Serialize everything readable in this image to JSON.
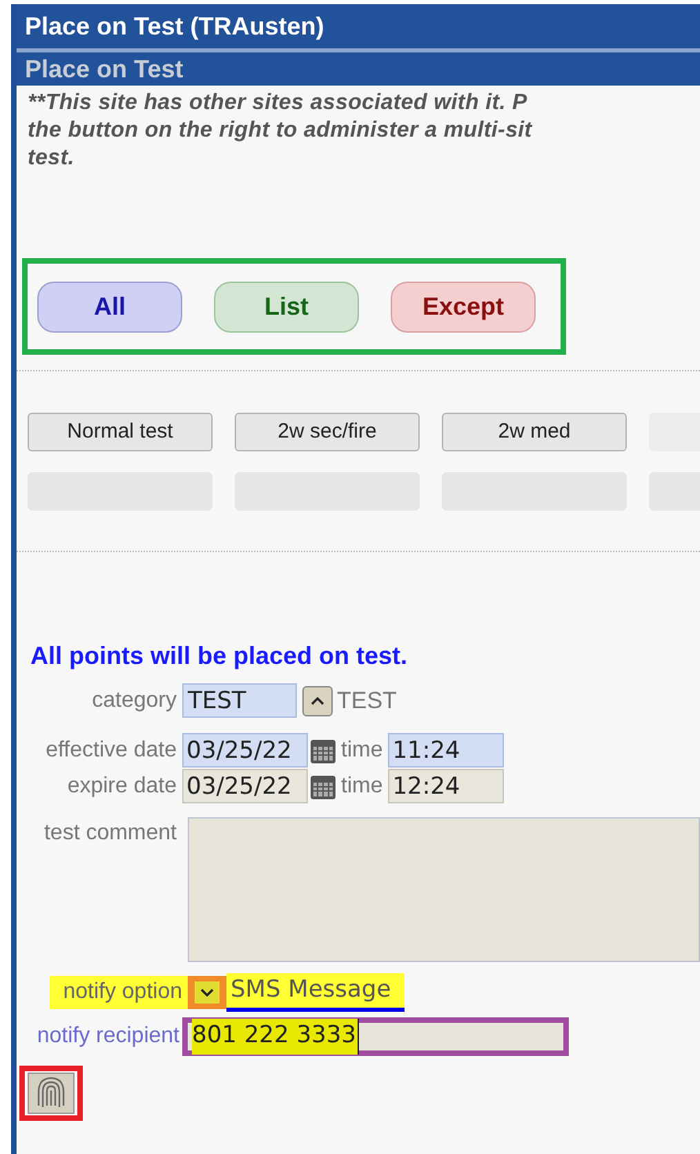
{
  "window": {
    "title": "Place on Test (TRAusten)"
  },
  "panel": {
    "title": "Place on Test"
  },
  "notice_lines": [
    "**This site has other sites associated with it.  P",
    "the button on the right to administer a multi-sit",
    "test."
  ],
  "scope_buttons": [
    {
      "label": "All",
      "kind": "all"
    },
    {
      "label": "List",
      "kind": "list"
    },
    {
      "label": "Except",
      "kind": "except"
    }
  ],
  "preset_buttons": [
    {
      "label": "Normal test"
    },
    {
      "label": "2w sec/fire"
    },
    {
      "label": "2w med"
    }
  ],
  "form": {
    "message": "All points will be placed on test.",
    "category": {
      "label": "category",
      "value": "TEST",
      "description": "TEST",
      "highlighted": true
    },
    "dates": [
      {
        "label": "effective date",
        "date": "03/25/22",
        "time_label": "time",
        "time": "11:24",
        "highlighted": true
      },
      {
        "label": "expire date",
        "date": "03/25/22",
        "time_label": "time",
        "time": "12:24",
        "highlighted": false
      }
    ],
    "comment": {
      "label": "test comment"
    },
    "notify_option": {
      "label": "notify option",
      "value": "SMS Message"
    },
    "notify_recipient": {
      "label": "notify recipient",
      "value": "801 222 3333"
    }
  }
}
